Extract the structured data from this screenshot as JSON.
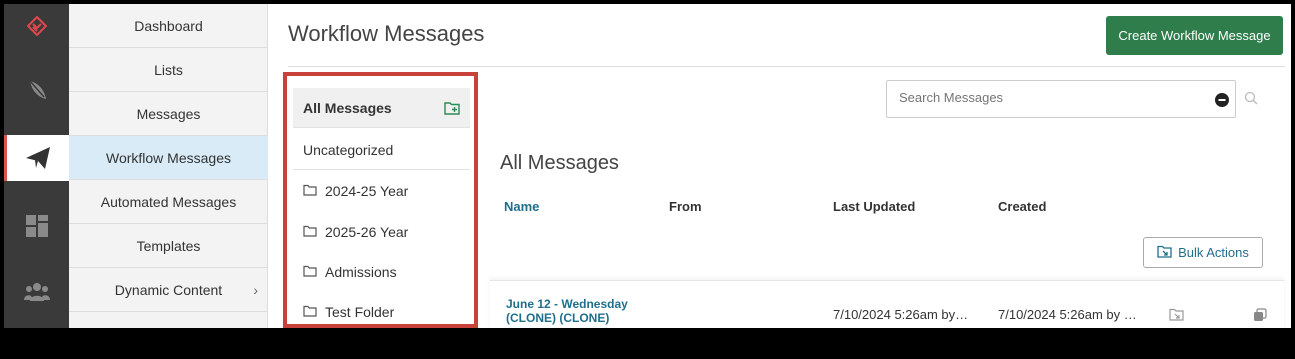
{
  "rail": {
    "items": [
      {
        "icon": "logo-icon"
      },
      {
        "icon": "feather-icon"
      },
      {
        "icon": "paper-plane-icon"
      },
      {
        "icon": "dashboard-tiles-icon"
      },
      {
        "icon": "people-group-icon"
      }
    ],
    "accent": "#d9534f"
  },
  "nav": {
    "items": [
      {
        "label": "Dashboard"
      },
      {
        "label": "Lists"
      },
      {
        "label": "Messages"
      },
      {
        "label": "Workflow Messages"
      },
      {
        "label": "Automated Messages"
      },
      {
        "label": "Templates"
      },
      {
        "label": "Dynamic Content",
        "chevron": "›"
      }
    ]
  },
  "header": {
    "title": "Workflow Messages",
    "create_button": "Create Workflow Message"
  },
  "folders": {
    "all_label": "All Messages",
    "uncategorized": "Uncategorized",
    "items": [
      "2024-25 Year",
      "2025-26 Year",
      "Admissions",
      "Test Folder"
    ]
  },
  "search": {
    "placeholder": "Search Messages"
  },
  "list": {
    "title": "All Messages",
    "columns": {
      "name": "Name",
      "from": "From",
      "last_updated": "Last Updated",
      "created": "Created"
    },
    "bulk_actions": "Bulk Actions",
    "rows": [
      {
        "name_line1": "June 12 - Wednesday",
        "name_line2": "(CLONE) (CLONE)",
        "from": "",
        "last_updated": "7/10/2024 5:26am by…",
        "created": "7/10/2024 5:26am by …"
      }
    ]
  },
  "colors": {
    "create_button": "#2e7d4a",
    "link": "#1f6f8b",
    "highlight_border": "#c8413a",
    "active_nav": "#d8ebf7"
  }
}
